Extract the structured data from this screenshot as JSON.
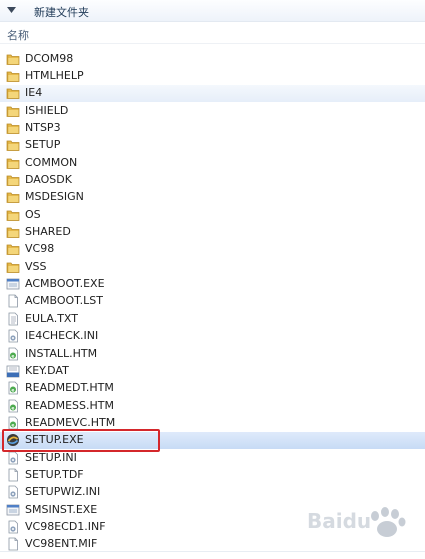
{
  "folder": {
    "title": "新建文件夹"
  },
  "columns": {
    "name": "名称"
  },
  "files": [
    {
      "name": "DCOM98",
      "icon": "folder-icon"
    },
    {
      "name": "HTMLHELP",
      "icon": "folder-icon"
    },
    {
      "name": "IE4",
      "icon": "folder-icon",
      "state": "hover"
    },
    {
      "name": "ISHIELD",
      "icon": "folder-icon"
    },
    {
      "name": "NTSP3",
      "icon": "folder-icon"
    },
    {
      "name": "SETUP",
      "icon": "folder-icon"
    },
    {
      "name": "COMMON",
      "icon": "folder-icon"
    },
    {
      "name": "DAOSDK",
      "icon": "folder-icon"
    },
    {
      "name": "MSDESIGN",
      "icon": "folder-icon"
    },
    {
      "name": "OS",
      "icon": "folder-icon"
    },
    {
      "name": "SHARED",
      "icon": "folder-icon"
    },
    {
      "name": "VC98",
      "icon": "folder-icon"
    },
    {
      "name": "VSS",
      "icon": "folder-icon"
    },
    {
      "name": "ACMBOOT.EXE",
      "icon": "exe-icon"
    },
    {
      "name": "ACMBOOT.LST",
      "icon": "file-icon"
    },
    {
      "name": "EULA.TXT",
      "icon": "text-file-icon"
    },
    {
      "name": "IE4CHECK.INI",
      "icon": "ini-file-icon"
    },
    {
      "name": "INSTALL.HTM",
      "icon": "html-file-icon"
    },
    {
      "name": "KEY.DAT",
      "icon": "dat-file-icon"
    },
    {
      "name": "READMEDT.HTM",
      "icon": "html-file-icon"
    },
    {
      "name": "READMESS.HTM",
      "icon": "html-file-icon"
    },
    {
      "name": "READMEVC.HTM",
      "icon": "html-file-icon"
    },
    {
      "name": "SETUP.EXE",
      "icon": "setup-exe-icon",
      "state": "selected"
    },
    {
      "name": "SETUP.INI",
      "icon": "ini-file-icon"
    },
    {
      "name": "SETUP.TDF",
      "icon": "file-icon"
    },
    {
      "name": "SETUPWIZ.INI",
      "icon": "ini-file-icon"
    },
    {
      "name": "SMSINST.EXE",
      "icon": "exe-icon"
    },
    {
      "name": "VC98ECD1.INF",
      "icon": "ini-file-icon"
    },
    {
      "name": "VC98ENT.MIF",
      "icon": "file-icon"
    }
  ],
  "watermark": {
    "brand": "Baidu",
    "icon": "baidu-paw-icon"
  },
  "colors": {
    "highlight": "#d4272b",
    "folder": "#e9c25a",
    "selection": "#c7dbf5"
  }
}
